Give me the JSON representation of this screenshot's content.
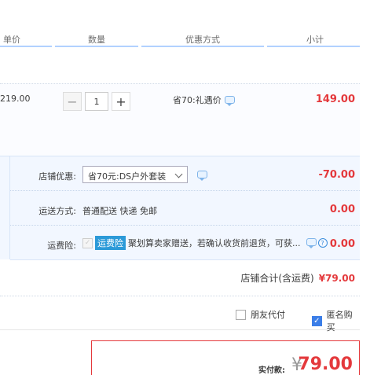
{
  "table_header": {
    "unit_price": "单价",
    "quantity": "数量",
    "promotion": "优惠方式",
    "subtotal": "小计"
  },
  "item": {
    "unit_price": "219.00",
    "quantity": "1",
    "promotion": "省70:礼遇价",
    "subtotal": "149.00"
  },
  "shop": {
    "discount_label": "店铺优惠:",
    "discount_selected": "省70元:DS户外套装",
    "discount_amount": "-70.00",
    "shipping_label": "运送方式:",
    "shipping_value": "普通配送 快递 免邮",
    "shipping_amount": "0.00",
    "insurance_label": "运费险:",
    "insurance_tag": "运费险",
    "insurance_text": "运费险",
    "insurance_desc": "聚划算卖家赠送，若确认收货前退货，可获...",
    "insurance_amount": "0.00",
    "total_label": "店铺合计(含运费)",
    "total_value": "¥79.00"
  },
  "options": {
    "friend_pay": "朋友代付",
    "anonymous": "匿名购买"
  },
  "payment": {
    "label": "实付款:",
    "currency": "¥",
    "amount": "79.00"
  },
  "colors": {
    "accent_red": "#e4393c",
    "blue": "#3b7ee8",
    "panel_bg": "#f2f7ff"
  },
  "icons": {
    "comment": "chat-bubble-icon",
    "help": "question-icon",
    "dropdown": "chevron-down-icon"
  }
}
